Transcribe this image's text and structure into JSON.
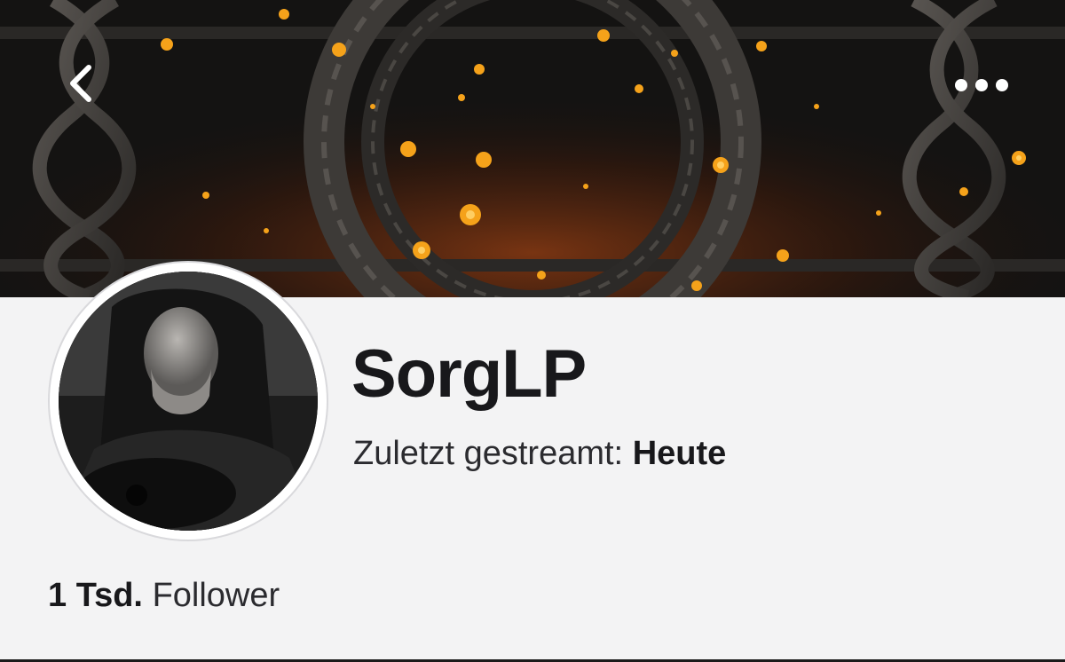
{
  "banner": {
    "back_icon": "chevron-left-icon",
    "more_icon": "more-horizontal-icon"
  },
  "channel": {
    "name": "SorgLP",
    "last_streamed_label": "Zuletzt gestreamt:",
    "last_streamed_value": "Heute",
    "followers_count": "1 Tsd.",
    "followers_label": "Follower"
  },
  "colors": {
    "background": "#f3f3f4",
    "text_primary": "#18181b",
    "ember": "#f5a21a"
  }
}
